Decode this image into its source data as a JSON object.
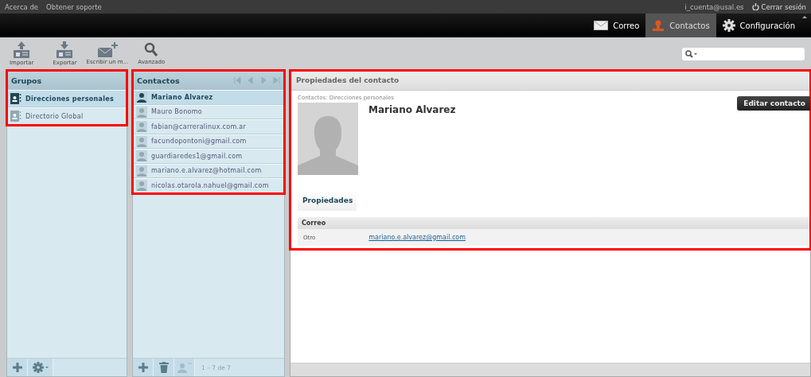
{
  "top_links": {
    "left": [
      "Acerca de",
      "Obtener soporte"
    ],
    "user": "i_cuenta@usal.es",
    "logout": "Cerrar sesión"
  },
  "nav": [
    {
      "label": "Correo",
      "selected": false
    },
    {
      "label": "Contactos",
      "selected": true
    },
    {
      "label": "Configuración",
      "selected": false
    }
  ],
  "toolbar": [
    {
      "label": "Importar"
    },
    {
      "label": "Exportar"
    },
    {
      "label": "Escribir un m..."
    },
    {
      "label": "Avanzado"
    }
  ],
  "groups": {
    "title": "Grupos",
    "highlight": true,
    "items": [
      {
        "label": "Direcciones personales",
        "selected": true
      },
      {
        "label": "Directorio Global",
        "selected": false
      }
    ]
  },
  "contacts": {
    "title": "Contactos",
    "highlight": true,
    "items": [
      {
        "label": "Mariano Alvarez",
        "selected": true
      },
      {
        "label": "Mauro Bonomo",
        "selected": false
      },
      {
        "label": "fabian@carreralinux.com.ar",
        "selected": false
      },
      {
        "label": "facundopontoni@gmail.com",
        "selected": false
      },
      {
        "label": "guardiaredes1@gmail.com",
        "selected": false
      },
      {
        "label": "mariano.e.alvarez@hotmail.com",
        "selected": false
      },
      {
        "label": "nicolas.otarola.nahuel@gmail.com",
        "selected": false
      }
    ],
    "count": "1 – 7 de 7"
  },
  "detail": {
    "title": "Propiedades del contacto",
    "highlight": true,
    "breadcrumb": "Contactos: Direcciones personales",
    "name": "Mariano Alvarez",
    "edit_button": "Editar contacto",
    "tabs": [
      {
        "label": "Propiedades",
        "selected": true
      }
    ],
    "section": "Correo",
    "fields": [
      {
        "label": "Otro",
        "value": "mariano.e.alvarez@gmail.com"
      }
    ]
  }
}
